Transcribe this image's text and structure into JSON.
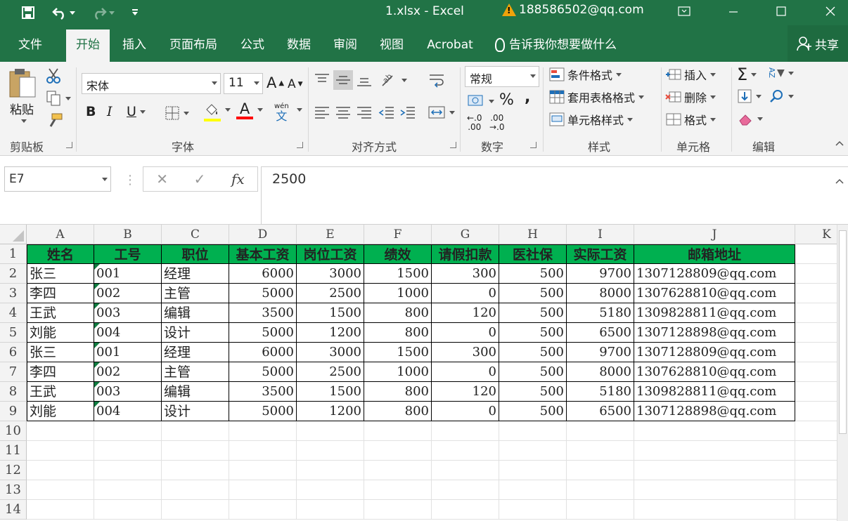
{
  "window": {
    "title": "1.xlsx  -  Excel",
    "account": "188586502@qq.com",
    "warning_glyph": "!"
  },
  "quick_access": {
    "save_icon": "save-icon",
    "undo_icon": "undo-icon",
    "redo_icon": "redo-icon",
    "customize_icon": "customize-icon"
  },
  "tabs": [
    "文件",
    "开始",
    "插入",
    "页面布局",
    "公式",
    "数据",
    "审阅",
    "视图",
    "Acrobat"
  ],
  "tell_me": "告诉我你想要做什么",
  "share": "共享",
  "ribbon": {
    "clipboard": {
      "paste": "粘贴",
      "label": "剪贴板"
    },
    "font": {
      "name": "宋体",
      "size": "11",
      "grow": "A",
      "shrink": "A",
      "bold": "B",
      "italic": "I",
      "underline": "U",
      "font_color_letter": "A",
      "phonetic_top": "wén",
      "phonetic_bottom": "文",
      "label": "字体"
    },
    "alignment": {
      "label": "对齐方式"
    },
    "number": {
      "format": "常规",
      "percent": "%",
      "comma": ",",
      "inc_decimal_top": "←.0",
      "inc_decimal_bottom": ".00",
      "dec_decimal_top": ".00",
      "dec_decimal_bottom": "→.0",
      "label": "数字"
    },
    "styles": {
      "conditional": "条件格式",
      "table": "套用表格格式",
      "cell_styles": "单元格样式",
      "label": "样式"
    },
    "cells": {
      "insert": "插入",
      "delete": "删除",
      "format": "格式",
      "label": "单元格"
    },
    "editing": {
      "sum": "Σ",
      "sort": "AZ",
      "label": "编辑"
    }
  },
  "formula_bar": {
    "name_box": "E7",
    "cancel": "✕",
    "enter": "✓",
    "fx": "fx",
    "value": "2500"
  },
  "sheet": {
    "columns": [
      "A",
      "B",
      "C",
      "D",
      "E",
      "F",
      "G",
      "H",
      "I",
      "J",
      "K"
    ],
    "rows": [
      "1",
      "2",
      "3",
      "4",
      "5",
      "6",
      "7",
      "8",
      "9",
      "10",
      "11",
      "12",
      "13",
      "14"
    ],
    "headers": [
      "姓名",
      "工号",
      "职位",
      "基本工资",
      "岗位工资",
      "绩效",
      "请假扣款",
      "医社保",
      "实际工资",
      "邮箱地址"
    ],
    "data": [
      [
        "张三",
        "001",
        "经理",
        "6000",
        "3000",
        "1500",
        "300",
        "500",
        "9700",
        "1307128809@qq.com"
      ],
      [
        "李四",
        "002",
        "主管",
        "5000",
        "2500",
        "1000",
        "0",
        "500",
        "8000",
        "1307628810@qq.com"
      ],
      [
        "王武",
        "003",
        "编辑",
        "3500",
        "1500",
        "800",
        "120",
        "500",
        "5180",
        "1309828811@qq.com"
      ],
      [
        "刘能",
        "004",
        "设计",
        "5000",
        "1200",
        "800",
        "0",
        "500",
        "6500",
        "1307128898@qq.com"
      ],
      [
        "张三",
        "001",
        "经理",
        "6000",
        "3000",
        "1500",
        "300",
        "500",
        "9700",
        "1307128809@qq.com"
      ],
      [
        "李四",
        "002",
        "主管",
        "5000",
        "2500",
        "1000",
        "0",
        "500",
        "8000",
        "1307628810@qq.com"
      ],
      [
        "王武",
        "003",
        "编辑",
        "3500",
        "1500",
        "800",
        "120",
        "500",
        "5180",
        "1309828811@qq.com"
      ],
      [
        "刘能",
        "004",
        "设计",
        "5000",
        "1200",
        "800",
        "0",
        "500",
        "6500",
        "1307128898@qq.com"
      ]
    ]
  },
  "colors": {
    "brand": "#217346",
    "header_fill": "#00b050",
    "text_triangle": "#107c41"
  }
}
